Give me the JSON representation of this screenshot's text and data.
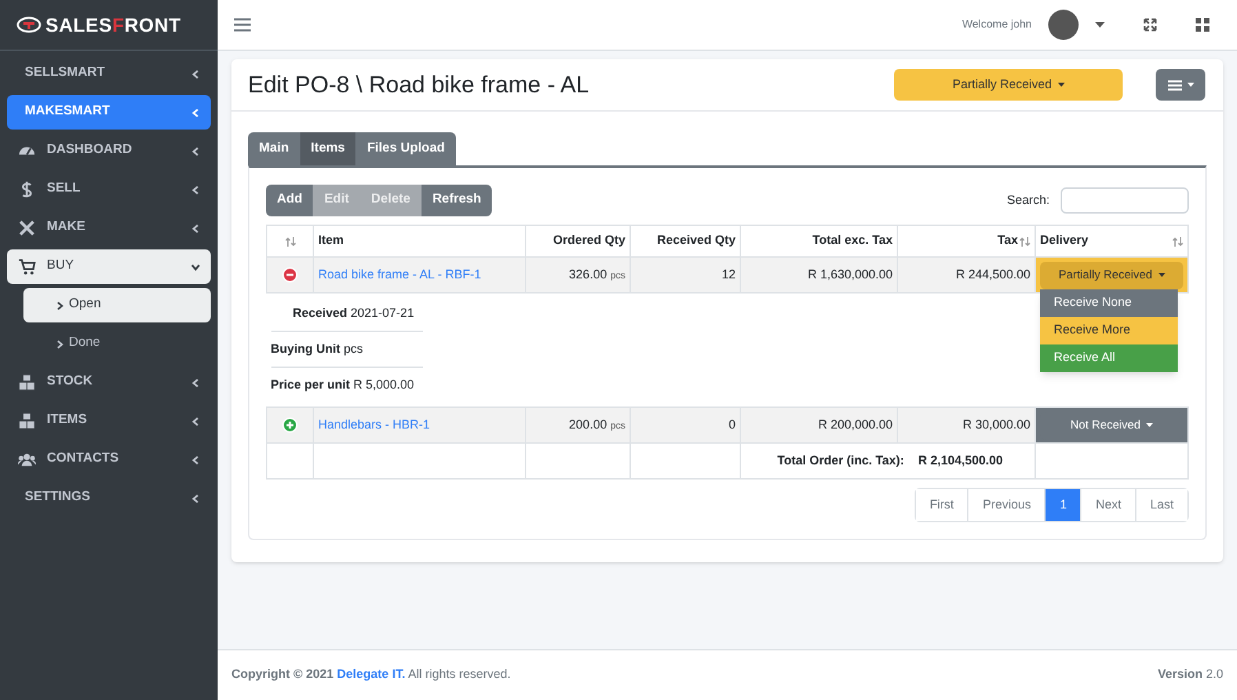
{
  "logo": {
    "prefix": "SALES",
    "accent": "F",
    "suffix": "RONT"
  },
  "sidebar": {
    "items": [
      {
        "label": "SELLSMART",
        "kind": "header",
        "selected": false,
        "expanded": false
      },
      {
        "label": "MAKESMART",
        "kind": "header",
        "selected": true,
        "expanded": false
      },
      {
        "label": "DASHBOARD",
        "kind": "nav",
        "selected": false,
        "expanded": false
      },
      {
        "label": "SELL",
        "kind": "nav",
        "selected": false,
        "expanded": false
      },
      {
        "label": "MAKE",
        "kind": "nav",
        "selected": false,
        "expanded": false
      },
      {
        "label": "BUY",
        "kind": "nav",
        "selected": false,
        "expanded": true,
        "children": [
          {
            "label": "Open",
            "selected": true
          },
          {
            "label": "Done",
            "selected": false
          }
        ]
      },
      {
        "label": "STOCK",
        "kind": "nav",
        "selected": false,
        "expanded": false
      },
      {
        "label": "ITEMS",
        "kind": "nav",
        "selected": false,
        "expanded": false
      },
      {
        "label": "CONTACTS",
        "kind": "nav",
        "selected": false,
        "expanded": false
      },
      {
        "label": "SETTINGS",
        "kind": "header",
        "selected": false,
        "expanded": false
      }
    ]
  },
  "topbar": {
    "welcome": "Welcome john"
  },
  "page": {
    "title": "Edit PO-8 \\ Road bike frame - AL",
    "status_button": "Partially Received"
  },
  "tabs": [
    {
      "label": "Main",
      "selected": false
    },
    {
      "label": "Items",
      "selected": true
    },
    {
      "label": "Files Upload",
      "selected": false
    }
  ],
  "toolbar": [
    {
      "label": "Add",
      "disabled": false
    },
    {
      "label": "Edit",
      "disabled": true
    },
    {
      "label": "Delete",
      "disabled": true
    },
    {
      "label": "Refresh",
      "disabled": false
    }
  ],
  "search": {
    "label": "Search:"
  },
  "table": {
    "columns": [
      {
        "sort_icon": true
      },
      {
        "label": "Item",
        "sort_icon": false
      },
      {
        "label": "Ordered Qty",
        "sort_icon": false
      },
      {
        "label": "Received Qty",
        "sort_icon": false
      },
      {
        "label": "Total exc. Tax",
        "sort_icon": false
      },
      {
        "label": "Tax",
        "sort_icon": true
      },
      {
        "label": "Delivery",
        "sort_icon": true
      }
    ],
    "rows": [
      {
        "expanded": true,
        "item": "Road bike frame - AL - RBF-1",
        "ordered": "326.00",
        "unit": "pcs",
        "received": "12",
        "total": "R 1,630,000.00",
        "tax": "R 244,500.00",
        "delivery": {
          "label": "Partially Received",
          "kind": "partial"
        },
        "details": [
          "**Received** 2021-07-21",
          "**Buying Unit** pcs",
          "**Price per unit** R 5,000.00"
        ]
      },
      {
        "expanded": false,
        "item": "Handlebars - HBR-1",
        "ordered": "200.00",
        "unit": "pcs",
        "received": "0",
        "total": "R 200,000.00",
        "tax": "R 30,000.00",
        "delivery": {
          "label": "Not Received",
          "kind": "none"
        }
      }
    ],
    "total_label": "Total Order (inc. Tax):",
    "total_value": "R 2,104,500.00"
  },
  "delivery_menu": [
    {
      "label": "Receive None",
      "kind": "none"
    },
    {
      "label": "Receive More",
      "kind": "more"
    },
    {
      "label": "Receive All",
      "kind": "all"
    }
  ],
  "pagination": [
    {
      "label": "First",
      "selected": false
    },
    {
      "label": "Previous",
      "selected": false
    },
    {
      "label": "1",
      "selected": true
    },
    {
      "label": "Next",
      "selected": false
    },
    {
      "label": "Last",
      "selected": false
    }
  ],
  "footer": {
    "copyright": "Copyright © 2021",
    "company": "Delegate IT.",
    "rights": "All rights reserved.",
    "version_label": "Version",
    "version": "2.0"
  }
}
